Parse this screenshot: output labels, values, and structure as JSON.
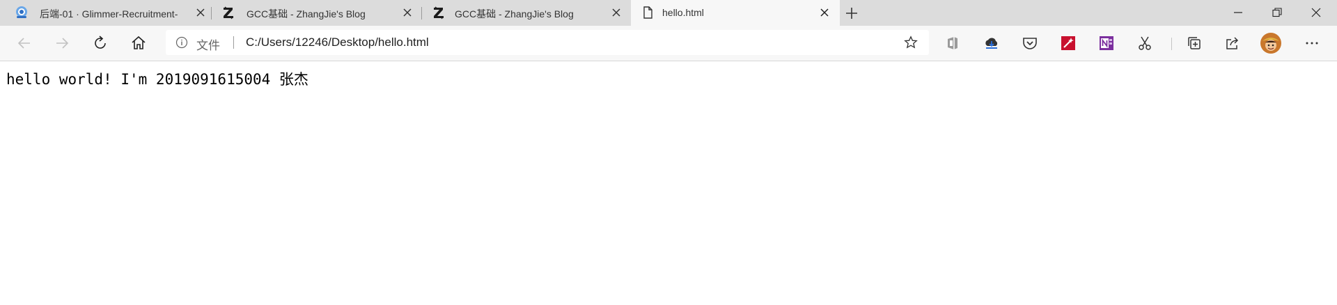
{
  "browser": {
    "tabs": [
      {
        "title": "后端-01 · Glimmer-Recruitment-",
        "icon": "glimmer-icon",
        "active": false
      },
      {
        "title": "GCC基础 - ZhangJie's Blog",
        "icon": "zhihu-z-icon",
        "active": false
      },
      {
        "title": "GCC基础 - ZhangJie's Blog",
        "icon": "zhihu-z-icon",
        "active": false
      },
      {
        "title": "hello.html",
        "icon": "file-icon",
        "active": true
      }
    ],
    "address": {
      "scheme_label": "文件",
      "url": "C:/Users/12246/Desktop/hello.html"
    }
  },
  "page": {
    "text": "hello world! I'm 2019091615004 张杰"
  },
  "colors": {
    "tabstrip_bg": "#dcdcdc",
    "toolbar_bg": "#f7f7f7",
    "onenote": "#7b2f9e",
    "red_ext": "#c8102e"
  }
}
